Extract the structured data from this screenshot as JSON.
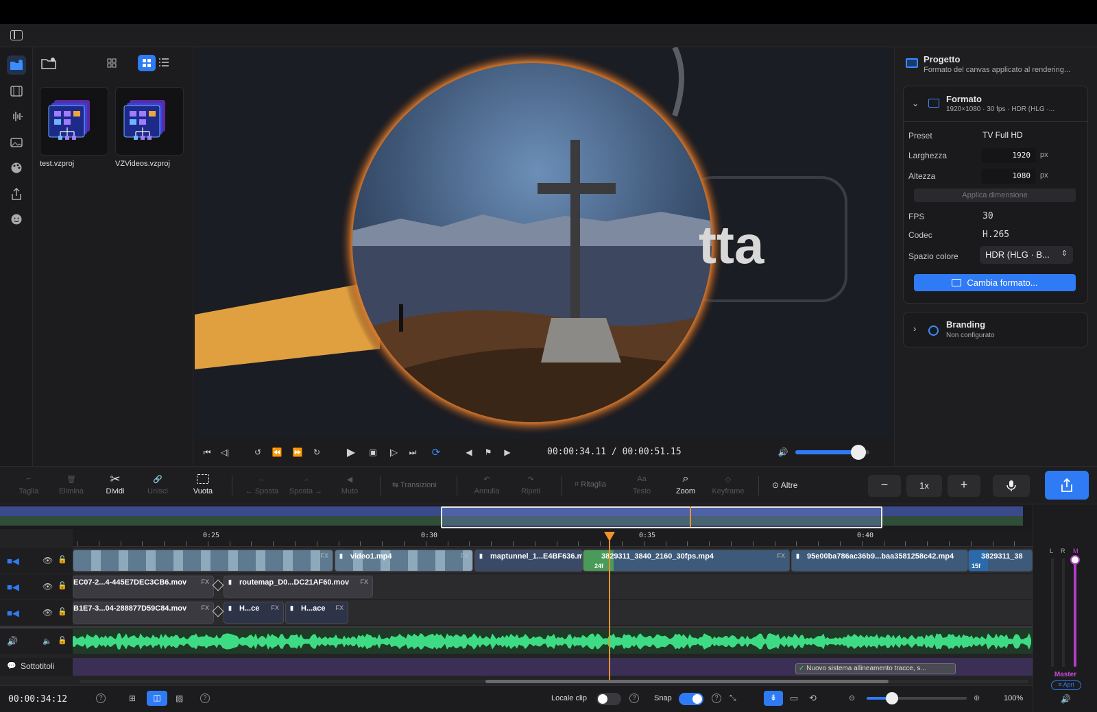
{
  "rail": {
    "icons": [
      "media-icon",
      "film-icon",
      "waveform-icon",
      "image-icon",
      "palette-icon",
      "share-icon",
      "emoji-icon"
    ]
  },
  "media": {
    "items": [
      {
        "name": "test.vzproj"
      },
      {
        "name": "VZVideos.vzproj"
      }
    ]
  },
  "viewer": {
    "overlay_text": "tta"
  },
  "transport": {
    "timecode": "00:00:34.11 / 00:00:51.15",
    "volume": 0.85
  },
  "project": {
    "title": "Progetto",
    "subtitle": "Formato del canvas applicato al rendering...",
    "format": {
      "title": "Formato",
      "summary": "1920×1080 · 30 fps · HDR (HLG ·...",
      "preset_label": "Preset",
      "preset_value": "TV Full HD",
      "width_label": "Larghezza",
      "width_value": "1920",
      "unit": "px",
      "height_label": "Altezza",
      "height_value": "1080",
      "apply_label": "Applica dimensione",
      "fps_label": "FPS",
      "fps_value": "30",
      "codec_label": "Codec",
      "codec_value": "H.265",
      "colorspace_label": "Spazio colore",
      "colorspace_value": "HDR (HLG · B...",
      "change_button": "Cambia formato..."
    },
    "branding": {
      "title": "Branding",
      "subtitle": "Non configurato"
    }
  },
  "toolbar": {
    "taglia": "Taglia",
    "elimina": "Elimina",
    "dividi": "Dividi",
    "unisci": "Unisci",
    "vuota": "Vuota",
    "sposta_left": "← Sposta",
    "sposta_right": "Sposta →",
    "muto": "Muto",
    "transizioni": "Transizioni",
    "annulla": "Annulla",
    "ripeti": "Ripeti",
    "ritaglia": "Ritaglia",
    "testo": "Testo",
    "zoom": "Zoom",
    "keyframe": "Keyframe",
    "altre": "Altre",
    "speed": "1x"
  },
  "timeline": {
    "ticks": [
      "0:25",
      "0:30",
      "0:35",
      "0:40"
    ],
    "track1": {
      "clip_video1": "video1.mp4",
      "clip_maptunnel": "maptunnel_1...E4BF636.m",
      "clip_3829311": "3829311_3840_2160_30fps.mp4",
      "clip_95e": "95e00ba786ac36b9...baa3581258c42.mp4",
      "clip_end": "3829311_38",
      "badge_24f": "24f",
      "badge_15f": "15f"
    },
    "track2": {
      "clip_a": "EC07-2...4-445E7DEC3CB6.mov",
      "clip_b": "routemap_D0...DC21AF60.mov"
    },
    "track3": {
      "clip_a": "B1E7-3...04-288877D59C84.mov",
      "clip_b": "H...ce",
      "clip_c": "H...ace"
    },
    "fx": "FX",
    "subtitles_label": "Sottotitoli",
    "subtitle_clip": "Nuovo sistema allineamento tracce, s..."
  },
  "meter": {
    "L": "L",
    "R": "R",
    "M": "M",
    "master": "Master",
    "apri": "Apri"
  },
  "status": {
    "timecode": "00:00:34:12",
    "locale_clip": "Locale clip",
    "snap": "Snap",
    "zoom_pct": "100%"
  },
  "colors": {
    "accent": "#2f7bf5",
    "playhead": "#f0932b",
    "audio": "#3ddc84",
    "subtitle_track": "#3b2f55"
  }
}
